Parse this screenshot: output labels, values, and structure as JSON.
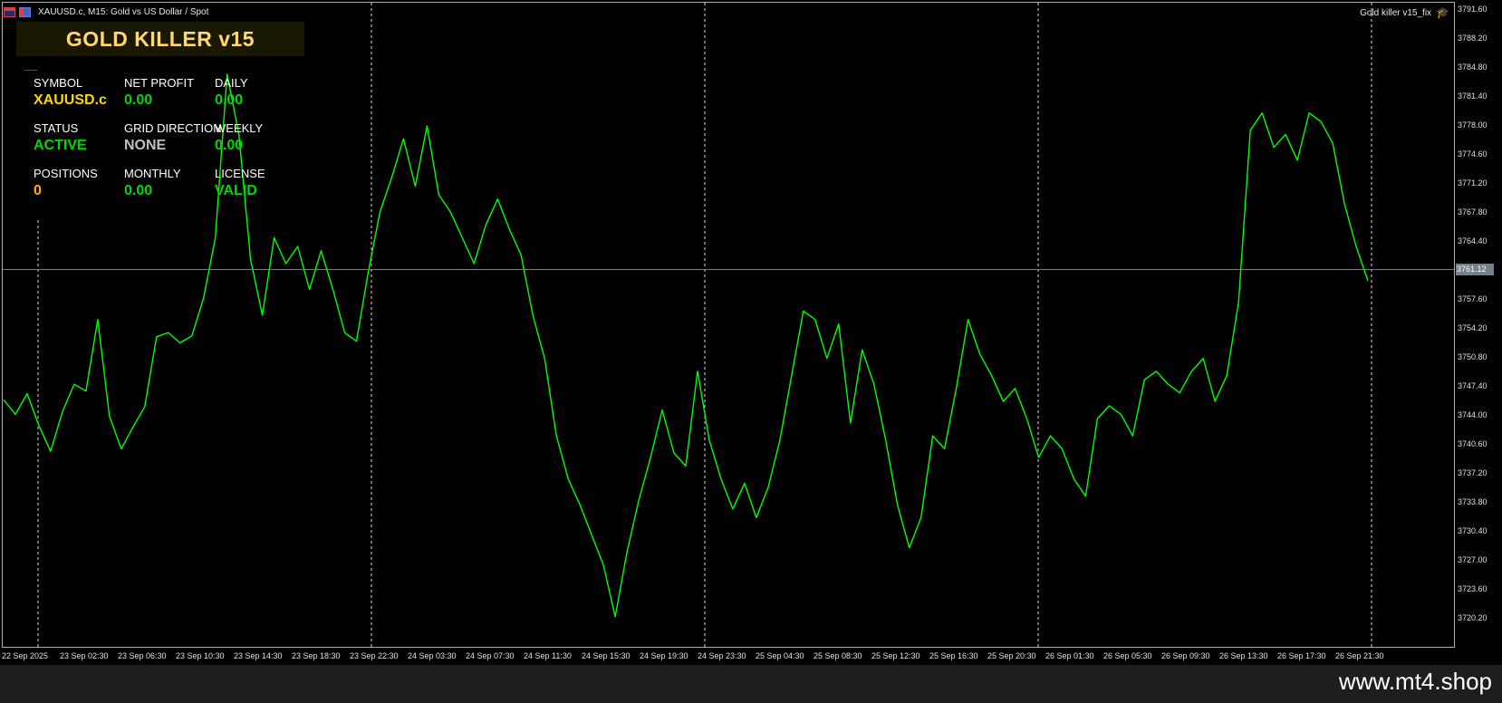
{
  "window": {
    "title": "XAUUSD.c, M15:  Gold vs US Dollar / Spot",
    "ea_name": "Gold killer v15_fix",
    "icons": [
      "menu-icon",
      "chart-type-icon",
      "expert-cap-icon"
    ]
  },
  "panel": {
    "title": "GOLD KILLER v15",
    "stats": [
      {
        "label": "SYMBOL",
        "value": "XAUUSD.c",
        "color": "#ffd700"
      },
      {
        "label": "NET PROFIT",
        "value": "0.00",
        "color": "#00d900"
      },
      {
        "label": "DAILY",
        "value": "0.00",
        "color": "#00d900"
      },
      {
        "label": "STATUS",
        "value": "ACTIVE",
        "color": "#00d900"
      },
      {
        "label": "GRID DIRECTION",
        "value": "NONE",
        "color": "#c0c0c0"
      },
      {
        "label": "WEEKLY",
        "value": "0.00",
        "color": "#00d900"
      },
      {
        "label": "POSITIONS",
        "value": "0",
        "color": "#ffb000"
      },
      {
        "label": "MONTHLY",
        "value": "0.00",
        "color": "#00d900"
      },
      {
        "label": "LICENSE",
        "value": "VALID",
        "color": "#00d900"
      }
    ]
  },
  "price_axis": {
    "labels": [
      "3791.60",
      "3788.20",
      "3784.80",
      "3781.40",
      "3778.00",
      "3774.60",
      "3771.20",
      "3767.80",
      "3764.40",
      "3761.12",
      "3757.60",
      "3754.20",
      "3750.80",
      "3747.40",
      "3744.00",
      "3740.60",
      "3737.20",
      "3733.80",
      "3730.40",
      "3727.00",
      "3723.60",
      "3720.20"
    ],
    "current_price": "3761.12"
  },
  "time_axis": {
    "labels": [
      "22 Sep 2025",
      "23 Sep 02:30",
      "23 Sep 06:30",
      "23 Sep 10:30",
      "23 Sep 14:30",
      "23 Sep 18:30",
      "23 Sep 22:30",
      "24 Sep 03:30",
      "24 Sep 07:30",
      "24 Sep 11:30",
      "24 Sep 15:30",
      "24 Sep 19:30",
      "24 Sep 23:30",
      "25 Sep 04:30",
      "25 Sep 08:30",
      "25 Sep 12:30",
      "25 Sep 16:30",
      "25 Sep 20:30",
      "26 Sep 01:30",
      "26 Sep 05:30",
      "26 Sep 09:30",
      "26 Sep 13:30",
      "26 Sep 17:30",
      "26 Sep 21:30"
    ]
  },
  "chart_data": {
    "type": "line",
    "series": [
      {
        "values": [
          3747.2,
          3745.5,
          3747.9,
          3744.2,
          3741.2,
          3745.8,
          3749.0,
          3748.2,
          3756.5,
          3745.3,
          3741.5,
          3744.0,
          3746.4,
          3754.5,
          3755.0,
          3753.8,
          3754.6,
          3759.0,
          3766.0,
          3785.0,
          3778.0,
          3763.5,
          3757.0,
          3766.0,
          3763.0,
          3765.0,
          3760.0,
          3764.5,
          3760.0,
          3755.0,
          3754.0,
          3762.0,
          3769.0,
          3773.0,
          3777.5,
          3772.0,
          3779.0,
          3771.0,
          3769.0,
          3766.0,
          3763.0,
          3767.5,
          3770.5,
          3767.0,
          3764.0,
          3757.0,
          3752.0,
          3743.0,
          3738.0,
          3735.0,
          3731.5,
          3728.0,
          3722.0,
          3729.5,
          3735.5,
          3740.5,
          3746.0,
          3741.0,
          3739.5,
          3750.5,
          3742.5,
          3738.0,
          3734.5,
          3737.5,
          3733.5,
          3737.0,
          3742.5,
          3750.0,
          3757.5,
          3756.5,
          3752.0,
          3756.0,
          3744.5,
          3753.0,
          3749.0,
          3742.5,
          3735.0,
          3730.0,
          3733.5,
          3743.0,
          3741.5,
          3748.5,
          3756.5,
          3752.5,
          3750.0,
          3747.0,
          3748.5,
          3745.0,
          3740.5,
          3743.0,
          3741.5,
          3738.0,
          3736.0,
          3745.0,
          3746.5,
          3745.5,
          3743.0,
          3749.5,
          3750.5,
          3749.0,
          3748.0,
          3750.5,
          3752.0,
          3747.0,
          3750.0,
          3758.5,
          3778.5,
          3780.5,
          3776.5,
          3778.0,
          3775.0,
          3780.5,
          3779.5,
          3777.0,
          3770.0,
          3765.0,
          3761.0
        ]
      }
    ],
    "title": "",
    "xlabel": "",
    "ylabel": "",
    "ylim": [
      3718.5,
      3793.3
    ],
    "grid": "vertical dashed separators",
    "color": "#00ff00"
  },
  "footer": {
    "watermark": "www.mt4.shop"
  }
}
